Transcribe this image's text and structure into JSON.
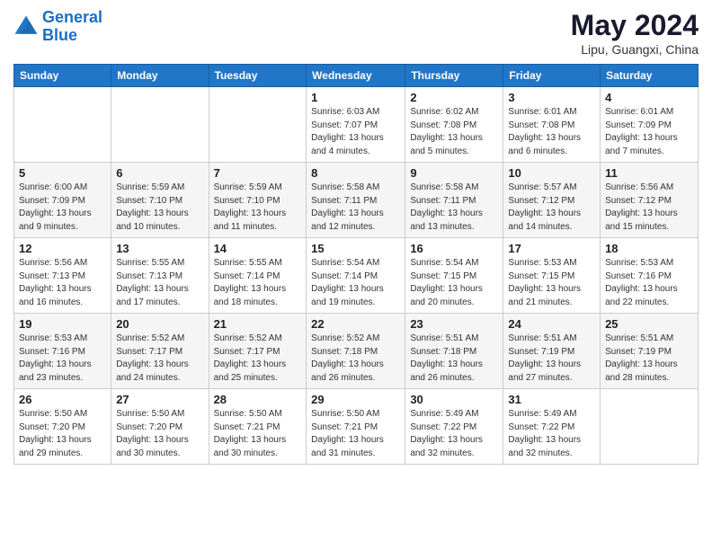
{
  "logo": {
    "line1": "General",
    "line2": "Blue"
  },
  "title": "May 2024",
  "location": "Lipu, Guangxi, China",
  "days_header": [
    "Sunday",
    "Monday",
    "Tuesday",
    "Wednesday",
    "Thursday",
    "Friday",
    "Saturday"
  ],
  "weeks": [
    [
      {
        "day": "",
        "sunrise": "",
        "sunset": "",
        "daylight": ""
      },
      {
        "day": "",
        "sunrise": "",
        "sunset": "",
        "daylight": ""
      },
      {
        "day": "",
        "sunrise": "",
        "sunset": "",
        "daylight": ""
      },
      {
        "day": "1",
        "sunrise": "Sunrise: 6:03 AM",
        "sunset": "Sunset: 7:07 PM",
        "daylight": "Daylight: 13 hours and 4 minutes."
      },
      {
        "day": "2",
        "sunrise": "Sunrise: 6:02 AM",
        "sunset": "Sunset: 7:08 PM",
        "daylight": "Daylight: 13 hours and 5 minutes."
      },
      {
        "day": "3",
        "sunrise": "Sunrise: 6:01 AM",
        "sunset": "Sunset: 7:08 PM",
        "daylight": "Daylight: 13 hours and 6 minutes."
      },
      {
        "day": "4",
        "sunrise": "Sunrise: 6:01 AM",
        "sunset": "Sunset: 7:09 PM",
        "daylight": "Daylight: 13 hours and 7 minutes."
      }
    ],
    [
      {
        "day": "5",
        "sunrise": "Sunrise: 6:00 AM",
        "sunset": "Sunset: 7:09 PM",
        "daylight": "Daylight: 13 hours and 9 minutes."
      },
      {
        "day": "6",
        "sunrise": "Sunrise: 5:59 AM",
        "sunset": "Sunset: 7:10 PM",
        "daylight": "Daylight: 13 hours and 10 minutes."
      },
      {
        "day": "7",
        "sunrise": "Sunrise: 5:59 AM",
        "sunset": "Sunset: 7:10 PM",
        "daylight": "Daylight: 13 hours and 11 minutes."
      },
      {
        "day": "8",
        "sunrise": "Sunrise: 5:58 AM",
        "sunset": "Sunset: 7:11 PM",
        "daylight": "Daylight: 13 hours and 12 minutes."
      },
      {
        "day": "9",
        "sunrise": "Sunrise: 5:58 AM",
        "sunset": "Sunset: 7:11 PM",
        "daylight": "Daylight: 13 hours and 13 minutes."
      },
      {
        "day": "10",
        "sunrise": "Sunrise: 5:57 AM",
        "sunset": "Sunset: 7:12 PM",
        "daylight": "Daylight: 13 hours and 14 minutes."
      },
      {
        "day": "11",
        "sunrise": "Sunrise: 5:56 AM",
        "sunset": "Sunset: 7:12 PM",
        "daylight": "Daylight: 13 hours and 15 minutes."
      }
    ],
    [
      {
        "day": "12",
        "sunrise": "Sunrise: 5:56 AM",
        "sunset": "Sunset: 7:13 PM",
        "daylight": "Daylight: 13 hours and 16 minutes."
      },
      {
        "day": "13",
        "sunrise": "Sunrise: 5:55 AM",
        "sunset": "Sunset: 7:13 PM",
        "daylight": "Daylight: 13 hours and 17 minutes."
      },
      {
        "day": "14",
        "sunrise": "Sunrise: 5:55 AM",
        "sunset": "Sunset: 7:14 PM",
        "daylight": "Daylight: 13 hours and 18 minutes."
      },
      {
        "day": "15",
        "sunrise": "Sunrise: 5:54 AM",
        "sunset": "Sunset: 7:14 PM",
        "daylight": "Daylight: 13 hours and 19 minutes."
      },
      {
        "day": "16",
        "sunrise": "Sunrise: 5:54 AM",
        "sunset": "Sunset: 7:15 PM",
        "daylight": "Daylight: 13 hours and 20 minutes."
      },
      {
        "day": "17",
        "sunrise": "Sunrise: 5:53 AM",
        "sunset": "Sunset: 7:15 PM",
        "daylight": "Daylight: 13 hours and 21 minutes."
      },
      {
        "day": "18",
        "sunrise": "Sunrise: 5:53 AM",
        "sunset": "Sunset: 7:16 PM",
        "daylight": "Daylight: 13 hours and 22 minutes."
      }
    ],
    [
      {
        "day": "19",
        "sunrise": "Sunrise: 5:53 AM",
        "sunset": "Sunset: 7:16 PM",
        "daylight": "Daylight: 13 hours and 23 minutes."
      },
      {
        "day": "20",
        "sunrise": "Sunrise: 5:52 AM",
        "sunset": "Sunset: 7:17 PM",
        "daylight": "Daylight: 13 hours and 24 minutes."
      },
      {
        "day": "21",
        "sunrise": "Sunrise: 5:52 AM",
        "sunset": "Sunset: 7:17 PM",
        "daylight": "Daylight: 13 hours and 25 minutes."
      },
      {
        "day": "22",
        "sunrise": "Sunrise: 5:52 AM",
        "sunset": "Sunset: 7:18 PM",
        "daylight": "Daylight: 13 hours and 26 minutes."
      },
      {
        "day": "23",
        "sunrise": "Sunrise: 5:51 AM",
        "sunset": "Sunset: 7:18 PM",
        "daylight": "Daylight: 13 hours and 26 minutes."
      },
      {
        "day": "24",
        "sunrise": "Sunrise: 5:51 AM",
        "sunset": "Sunset: 7:19 PM",
        "daylight": "Daylight: 13 hours and 27 minutes."
      },
      {
        "day": "25",
        "sunrise": "Sunrise: 5:51 AM",
        "sunset": "Sunset: 7:19 PM",
        "daylight": "Daylight: 13 hours and 28 minutes."
      }
    ],
    [
      {
        "day": "26",
        "sunrise": "Sunrise: 5:50 AM",
        "sunset": "Sunset: 7:20 PM",
        "daylight": "Daylight: 13 hours and 29 minutes."
      },
      {
        "day": "27",
        "sunrise": "Sunrise: 5:50 AM",
        "sunset": "Sunset: 7:20 PM",
        "daylight": "Daylight: 13 hours and 30 minutes."
      },
      {
        "day": "28",
        "sunrise": "Sunrise: 5:50 AM",
        "sunset": "Sunset: 7:21 PM",
        "daylight": "Daylight: 13 hours and 30 minutes."
      },
      {
        "day": "29",
        "sunrise": "Sunrise: 5:50 AM",
        "sunset": "Sunset: 7:21 PM",
        "daylight": "Daylight: 13 hours and 31 minutes."
      },
      {
        "day": "30",
        "sunrise": "Sunrise: 5:49 AM",
        "sunset": "Sunset: 7:22 PM",
        "daylight": "Daylight: 13 hours and 32 minutes."
      },
      {
        "day": "31",
        "sunrise": "Sunrise: 5:49 AM",
        "sunset": "Sunset: 7:22 PM",
        "daylight": "Daylight: 13 hours and 32 minutes."
      },
      {
        "day": "",
        "sunrise": "",
        "sunset": "",
        "daylight": ""
      }
    ]
  ]
}
